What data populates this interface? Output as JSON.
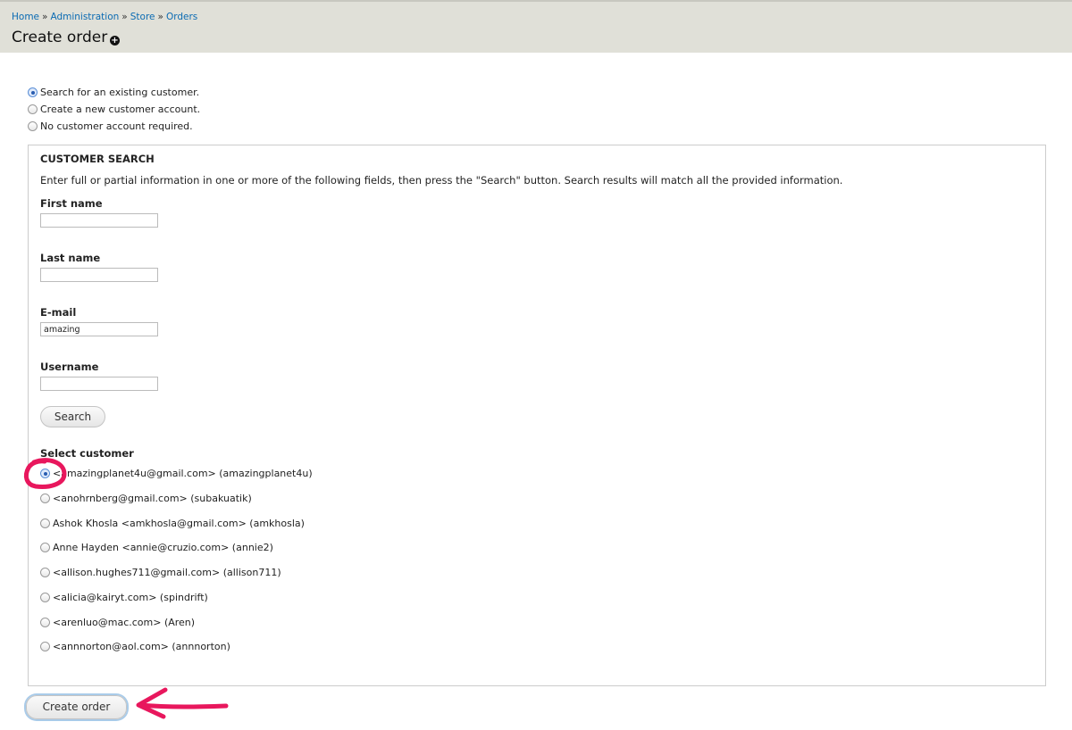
{
  "breadcrumb": {
    "items": [
      "Home",
      "Administration",
      "Store",
      "Orders"
    ],
    "separator": "»"
  },
  "page": {
    "title": "Create order",
    "add_icon_glyph": "+"
  },
  "customer_type": {
    "options": [
      {
        "label": "Search for an existing customer.",
        "checked": true
      },
      {
        "label": "Create a new customer account.",
        "checked": false
      },
      {
        "label": "No customer account required.",
        "checked": false
      }
    ]
  },
  "search": {
    "legend": "CUSTOMER SEARCH",
    "description": "Enter full or partial information in one or more of the following fields, then press the \"Search\" button. Search results will match all the provided information.",
    "fields": [
      {
        "label": "First name",
        "value": ""
      },
      {
        "label": "Last name",
        "value": ""
      },
      {
        "label": "E-mail",
        "value": "amazing"
      },
      {
        "label": "Username",
        "value": ""
      }
    ],
    "search_button": "Search",
    "select_label": "Select customer",
    "customers": [
      {
        "label": "<amazingplanet4u@gmail.com> (amazingplanet4u)",
        "checked": true
      },
      {
        "label": "<anohrnberg@gmail.com> (subakuatik)",
        "checked": false
      },
      {
        "label": "Ashok Khosla <amkhosla@gmail.com> (amkhosla)",
        "checked": false
      },
      {
        "label": "Anne Hayden <annie@cruzio.com> (annie2)",
        "checked": false
      },
      {
        "label": "<allison.hughes711@gmail.com> (allison711)",
        "checked": false
      },
      {
        "label": "<alicia@kairyt.com> (spindrift)",
        "checked": false
      },
      {
        "label": "<arenluo@mac.com> (Aren)",
        "checked": false
      },
      {
        "label": "<annnorton@aol.com> (annnorton)",
        "checked": false
      }
    ]
  },
  "actions": {
    "create_order": "Create order"
  },
  "colors": {
    "link": "#0b6bb3",
    "header_bg": "#e0e0d8",
    "annotation": "#e8175d"
  }
}
